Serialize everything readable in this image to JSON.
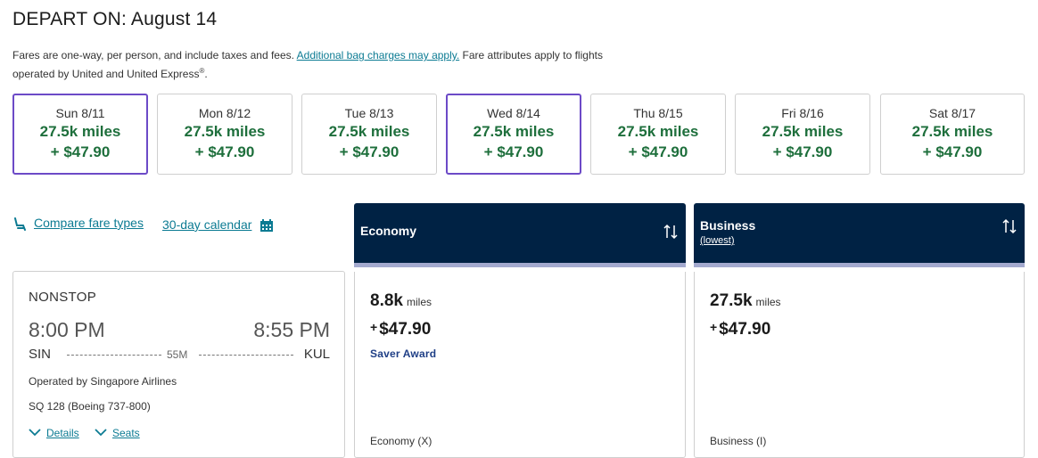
{
  "page_title": "DEPART ON: August 14",
  "fare_note": {
    "text1": "Fares are one-way, per person, and include taxes and fees. ",
    "link": "Additional bag charges may apply.",
    "text2": " Fare attributes apply to flights",
    "text3": "operated by United and United Express",
    "reg": "®",
    "end": "."
  },
  "date_options": [
    {
      "day": "Sun 8/11",
      "miles": "27.5k miles",
      "cash": "+ $47.90"
    },
    {
      "day": "Mon 8/12",
      "miles": "27.5k miles",
      "cash": "+ $47.90"
    },
    {
      "day": "Tue 8/13",
      "miles": "27.5k miles",
      "cash": "+ $47.90"
    },
    {
      "day": "Wed 8/14",
      "miles": "27.5k miles",
      "cash": "+ $47.90"
    },
    {
      "day": "Thu 8/15",
      "miles": "27.5k miles",
      "cash": "+ $47.90"
    },
    {
      "day": "Fri 8/16",
      "miles": "27.5k miles",
      "cash": "+ $47.90"
    },
    {
      "day": "Sat 8/17",
      "miles": "27.5k miles",
      "cash": "+ $47.90"
    }
  ],
  "tools": {
    "compare_label": "Compare fare types",
    "calendar_label": "30-day calendar"
  },
  "flight": {
    "stops": "NONSTOP",
    "depart_time": "8:00 PM",
    "arrive_time": "8:55 PM",
    "origin": "SIN",
    "destination": "KUL",
    "duration": "55M",
    "operator": "Operated by Singapore Airlines",
    "flight_number": "SQ 128 (Boeing 737-800)",
    "details_label": "Details",
    "seats_label": "Seats"
  },
  "cabins": [
    {
      "name": "Economy",
      "sub": "",
      "miles": "8.8k",
      "miles_unit": "miles",
      "plus": "+",
      "cash": "$47.90",
      "tag": "Saver Award",
      "fare_class": "Economy (X)"
    },
    {
      "name": "Business",
      "sub": "(lowest)",
      "miles": "27.5k",
      "miles_unit": "miles",
      "plus": "+",
      "cash": "$47.90",
      "tag": "",
      "fare_class": "Business (I)"
    }
  ],
  "colors": {
    "accent_purple": "#6c4ac7",
    "fare_green": "#1e6f3c",
    "link_teal": "#0c7b93",
    "header_navy": "#002244",
    "saver_blue": "#1f3f86"
  },
  "icons": {
    "seat": "seat-icon",
    "calendar": "calendar-icon",
    "sort": "sort-icon",
    "chevron": "chevron-down-icon"
  }
}
